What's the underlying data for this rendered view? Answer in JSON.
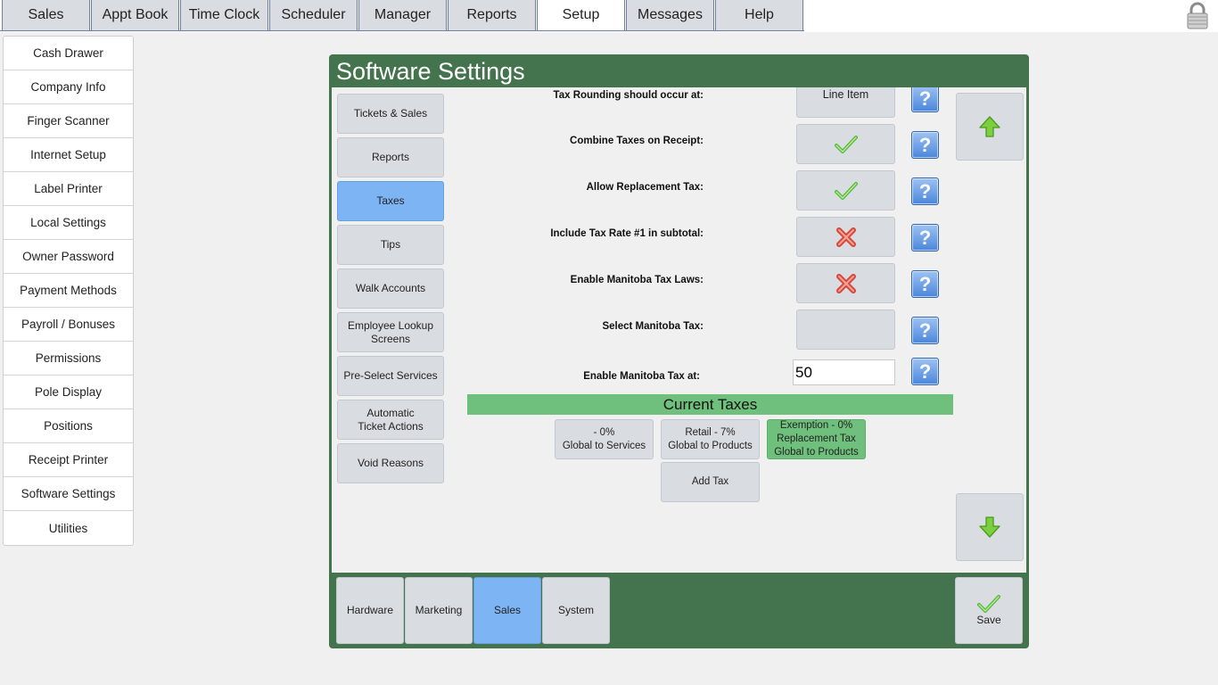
{
  "nav": {
    "tabs": [
      "Sales",
      "Appt Book",
      "Time Clock",
      "Scheduler",
      "Manager",
      "Reports",
      "Setup",
      "Messages",
      "Help"
    ],
    "active_tab": "Setup"
  },
  "left_menu": {
    "items": [
      "Cash Drawer",
      "Company Info",
      "Finger Scanner",
      "Internet Setup",
      "Label Printer",
      "Local Settings",
      "Owner Password",
      "Payment Methods",
      "Payroll / Bonuses",
      "Permissions",
      "Pole Display",
      "Positions",
      "Receipt Printer",
      "Software Settings",
      "Utilities"
    ]
  },
  "dialog": {
    "title": "Software Settings",
    "categories": [
      "Tickets & Sales",
      "Reports",
      "Taxes",
      "Tips",
      "Walk Accounts",
      "Employee Lookup Screens",
      "Pre-Select Services",
      "Automatic Ticket Actions",
      "Void Reasons"
    ],
    "active_category": "Taxes",
    "settings": {
      "tax_rounding": {
        "label": "Tax Rounding should occur at:",
        "value": "Line Item"
      },
      "combine_taxes": {
        "label": "Combine Taxes on Receipt:",
        "value": "check"
      },
      "allow_replacement": {
        "label": "Allow Replacement Tax:",
        "value": "check"
      },
      "include_rate1": {
        "label": "Include Tax Rate #1 in subtotal:",
        "value": "x"
      },
      "enable_manitoba": {
        "label": "Enable Manitoba Tax Laws:",
        "value": "x"
      },
      "select_manitoba": {
        "label": "Select Manitoba Tax:",
        "value": ""
      },
      "enable_manitoba_at": {
        "label": "Enable Manitoba Tax at:",
        "value": "50"
      }
    },
    "current_taxes": {
      "heading": "Current Taxes",
      "taxes": [
        {
          "line1": "- 0%",
          "line2": "Global to Services",
          "line3": ""
        },
        {
          "line1": "Retail - 7%",
          "line2": "Global to Products",
          "line3": ""
        },
        {
          "line1": "Exemption - 0%",
          "line2": "Replacement Tax",
          "line3": "Global to Products"
        }
      ],
      "add_tax_label": "Add Tax"
    },
    "bottom_tabs": [
      "Hardware",
      "Marketing",
      "Sales",
      "System"
    ],
    "active_bottom_tab": "Sales",
    "save_label": "Save"
  },
  "colors": {
    "dialog_green": "#44744e",
    "active_blue": "#7db4f4",
    "tax_green": "#6fc07c",
    "button_gray": "#d9dde2"
  },
  "icons": [
    "lock-icon",
    "up-arrow-icon",
    "down-arrow-icon",
    "checkmark-icon",
    "x-icon",
    "help-icon",
    "save-check-icon"
  ]
}
